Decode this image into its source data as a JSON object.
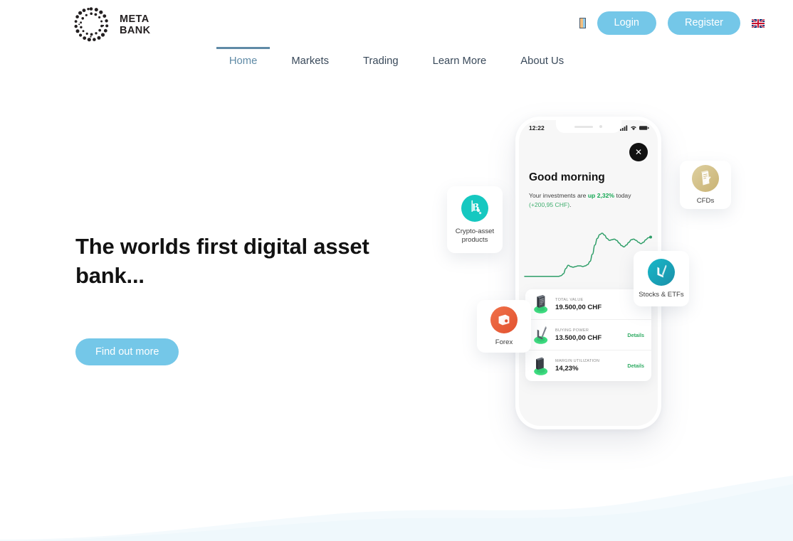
{
  "brand": {
    "name_line1": "META",
    "name_line2": "BANK",
    "logo_icon": "dotted-circle-logo"
  },
  "header": {
    "tofu_icon": "unknown-glyph-icon",
    "login_label": "Login",
    "register_label": "Register",
    "flag_icon": "uk-flag-icon",
    "accent_color": "#74c7e8"
  },
  "nav": {
    "items": [
      {
        "label": "Home",
        "active": true
      },
      {
        "label": "Markets",
        "active": false
      },
      {
        "label": "Trading",
        "active": false
      },
      {
        "label": "Learn More",
        "active": false
      },
      {
        "label": "About Us",
        "active": false
      }
    ],
    "active_color": "#5f8aa6"
  },
  "hero": {
    "title": "The worlds first digital asset bank...",
    "cta_label": "Find out more"
  },
  "phone": {
    "status_time": "12:22",
    "signal_icon": "cellular-signal-icon",
    "wifi_icon": "wifi-icon",
    "battery_icon": "battery-icon",
    "close_label": "✕",
    "greeting": "Good morning",
    "sub_prefix": "Your investments are ",
    "sub_highlight": "up 2,32%",
    "sub_middle": " today",
    "sub_chf": "(+200,95 CHF)",
    "sub_suffix": ".",
    "stats": [
      {
        "label": "TOTAL VALUE",
        "value": "19.500,00 CHF",
        "details": "",
        "icon": "green-document-stack-icon"
      },
      {
        "label": "BUYING POWER",
        "value": "13.500,00 CHF",
        "details": "Details",
        "icon": "green-check-arrow-icon"
      },
      {
        "label": "MARGIN UTILIZATION",
        "value": "14,23%",
        "details": "Details",
        "icon": "green-cylinder-icon"
      }
    ]
  },
  "feature_cards": [
    {
      "label": "Crypto-asset products",
      "icon": "bitcoin-icon",
      "color": "#15c8c0"
    },
    {
      "label": "CFDs",
      "icon": "contract-scroll-icon",
      "color": "#c9b273"
    },
    {
      "label": "Stocks & ETFs",
      "icon": "chart-arrow-icon",
      "color": "#1a8fa8"
    },
    {
      "label": "Forex",
      "icon": "wallet-icon",
      "color": "#e2522f"
    }
  ],
  "chart_data": {
    "type": "line",
    "title": "",
    "xlabel": "",
    "ylabel": "",
    "series": [
      {
        "name": "Portfolio value",
        "color": "#2e9e68",
        "values": [
          22,
          22,
          22,
          22,
          22,
          22,
          22,
          22,
          22,
          22,
          22,
          22,
          22,
          22,
          22,
          23,
          26,
          34,
          39,
          37,
          36,
          37,
          38,
          38,
          37,
          38,
          40,
          45,
          56,
          70,
          80,
          86,
          88,
          85,
          80,
          77,
          78,
          79,
          77,
          73,
          69,
          67,
          70,
          74,
          78,
          79,
          77,
          74,
          72,
          74,
          78,
          81,
          82
        ]
      }
    ],
    "ylim": [
      0,
      100
    ],
    "grid": false,
    "legend": "none",
    "end_marker": true
  },
  "decor": {
    "wave_color_1": "#eff8fc",
    "wave_color_2": "#f4fafd"
  }
}
